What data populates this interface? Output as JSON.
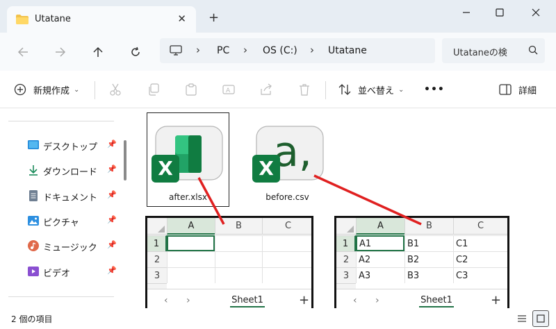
{
  "window": {
    "tab_title": "Utatane",
    "new_tab": "+",
    "close_tab": "✕",
    "minimize": "—",
    "maximize": "☐",
    "close": "✕"
  },
  "address": {
    "segments": [
      "PC",
      "OS (C:)",
      "Utatane"
    ],
    "search_placeholder": "Utataneの検"
  },
  "toolbar": {
    "new_label": "新規作成",
    "sort_label": "並べ替え",
    "more_label": "•••",
    "details_label": "詳細"
  },
  "sidebar": {
    "items": [
      {
        "label": "デスクトップ",
        "icon": "desktop-icon"
      },
      {
        "label": "ダウンロード",
        "icon": "download-icon"
      },
      {
        "label": "ドキュメント",
        "icon": "document-icon"
      },
      {
        "label": "ピクチャ",
        "icon": "pictures-icon"
      },
      {
        "label": "ミュージック",
        "icon": "music-icon"
      },
      {
        "label": "ビデオ",
        "icon": "video-icon"
      }
    ]
  },
  "files": [
    {
      "name": "after.xlsx"
    },
    {
      "name": "before.csv"
    }
  ],
  "sheets": {
    "after": {
      "columns": [
        "A",
        "B",
        "C"
      ],
      "rows": [
        "1",
        "2",
        "3"
      ],
      "cells": [
        [
          "",
          "",
          ""
        ],
        [
          "",
          "",
          ""
        ],
        [
          "",
          "",
          ""
        ]
      ],
      "tab": "Sheet1",
      "plus": "+"
    },
    "before": {
      "columns": [
        "A",
        "B",
        "C"
      ],
      "rows": [
        "1",
        "2",
        "3"
      ],
      "cells": [
        [
          "A1",
          "B1",
          "C1"
        ],
        [
          "A2",
          "B2",
          "C2"
        ],
        [
          "A3",
          "B3",
          "C3"
        ]
      ],
      "tab": "Sheet1",
      "plus": "+"
    }
  },
  "status": {
    "item_count": "2 個の項目"
  },
  "colors": {
    "excel_green": "#217346",
    "arrow_red": "#e02020",
    "selection_green": "#d9e7da"
  }
}
